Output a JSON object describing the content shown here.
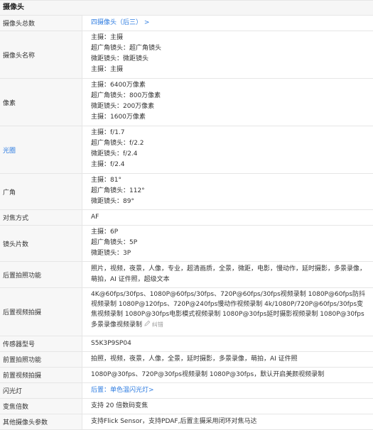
{
  "section_title": "摄像头",
  "rows": {
    "camera_total": {
      "label": "摄像头总数",
      "value": "四摄像头（后三） >"
    },
    "camera_names": {
      "label": "摄像头名称",
      "lines": [
        "主摄：主摄",
        "超广角镜头：超广角镜头",
        "微距镜头：微距镜头",
        "主摄：主摄"
      ]
    },
    "pixels": {
      "label": "像素",
      "lines": [
        "主摄：6400万像素",
        "超广角镜头：800万像素",
        "微距镜头：200万像素",
        "主摄：1600万像素"
      ]
    },
    "aperture": {
      "label": "光圈",
      "lines": [
        "主摄：f/1.7",
        "超广角镜头：f/2.2",
        "微距镜头：f/2.4",
        "主摄：f/2.4"
      ]
    },
    "wide_angle": {
      "label": "广角",
      "lines": [
        "主摄：81°",
        "超广角镜头：112°",
        "微距镜头：89°"
      ]
    },
    "focus": {
      "label": "对焦方式",
      "value": "AF"
    },
    "lens_count": {
      "label": "镜头片数",
      "lines": [
        "主摄：6P",
        "超广角镜头：5P",
        "微距镜头：3P"
      ]
    },
    "rear_photo": {
      "label": "后置拍照功能",
      "value": "照片，视频，夜景，人像，专业，超清画质，全景，微距，电影，慢动作，延时摄影，多景录像，萌拍，AI 证件照，超级文本"
    },
    "rear_video": {
      "label": "后置视频拍摄",
      "value": "4K@60fps/30fps、1080P@60fps/30fps、720P@60fps/30fps视频录制 1080P@60fps防抖视频录制 1080P@120fps、720P@240fps慢动作视频录制 4k/1080P/720P@60fps/30fps变焦视频录制 1080P@30fps电影模式视频录制 1080P@30fps延时摄影视频录制 1080P@30fps多景录像视频录制",
      "edit_label": "纠错"
    },
    "sensor": {
      "label": "传感器型号",
      "value": "S5K3P9SP04"
    },
    "front_photo": {
      "label": "前置拍照功能",
      "value": "拍照，视频，夜景，人像，全景，延时摄影，多景录像，萌拍，AI 证件照"
    },
    "front_video": {
      "label": "前置视频拍摄",
      "value": "1080P@30fps、720P@30fps视频录制 1080P@30fps，默认开启美颜视频录制"
    },
    "flash": {
      "label": "闪光灯",
      "value": "后置：单色温闪光灯>"
    },
    "zoom": {
      "label": "变焦倍数",
      "value": "支持 20 倍数码变焦"
    },
    "other": {
      "label": "其他摄像头参数",
      "value": "支持Flick Sensor，支持PDAF,后置主摄采用闭环对焦马达"
    }
  },
  "colors": {
    "link": "#2f7de1",
    "label_bg": "#f7f7f7",
    "border": "#e6e6e6"
  },
  "icons": {
    "edit": "pencil-icon"
  }
}
